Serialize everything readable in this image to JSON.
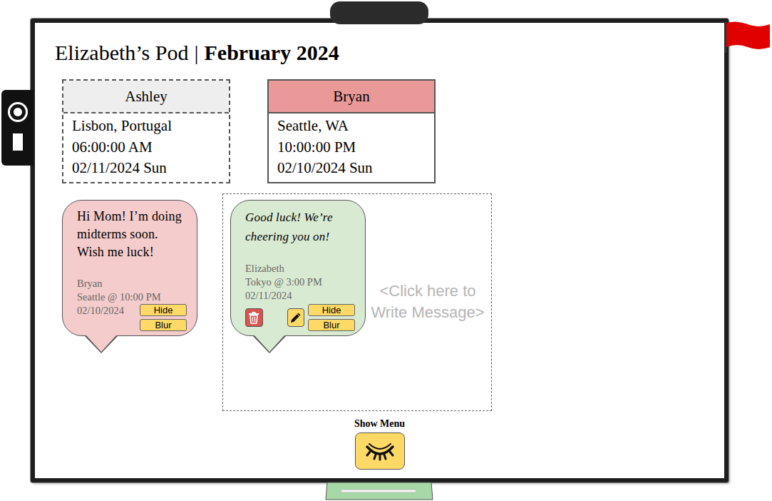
{
  "pod": {
    "name": "Elizabeth’s Pod",
    "separator": "|",
    "month": "February 2024"
  },
  "members": [
    {
      "name": "Ashley",
      "location": "Lisbon, Portugal",
      "time": "06:00:00 AM",
      "date": "02/11/2024 Sun",
      "active": false,
      "color": "#eeeeee"
    },
    {
      "name": "Bryan",
      "location": "Seattle, WA",
      "time": "10:00:00 PM",
      "date": "02/10/2024 Sun",
      "active": true,
      "color": "#ea9999"
    }
  ],
  "messages": [
    {
      "kind": "received",
      "text": "Hi Mom! I’m doing midterms soon. Wish me luck!",
      "author": "Bryan",
      "place_time": "Seattle @ 10:00 PM",
      "date": "02/10/2024",
      "color": "#f4cccc",
      "buttons": [
        "Hide",
        "Blur"
      ]
    },
    {
      "kind": "sent",
      "text": "Good luck! We’re cheering you on!",
      "author": "Elizabeth",
      "place_time": "Tokyo @ 3:00 PM",
      "date": "02/11/2024",
      "color": "#d9ead3",
      "buttons": [
        "Hide",
        "Blur"
      ]
    }
  ],
  "compose": {
    "hint": "<Click here to Write Message>"
  },
  "menu": {
    "label": "Show Menu"
  }
}
